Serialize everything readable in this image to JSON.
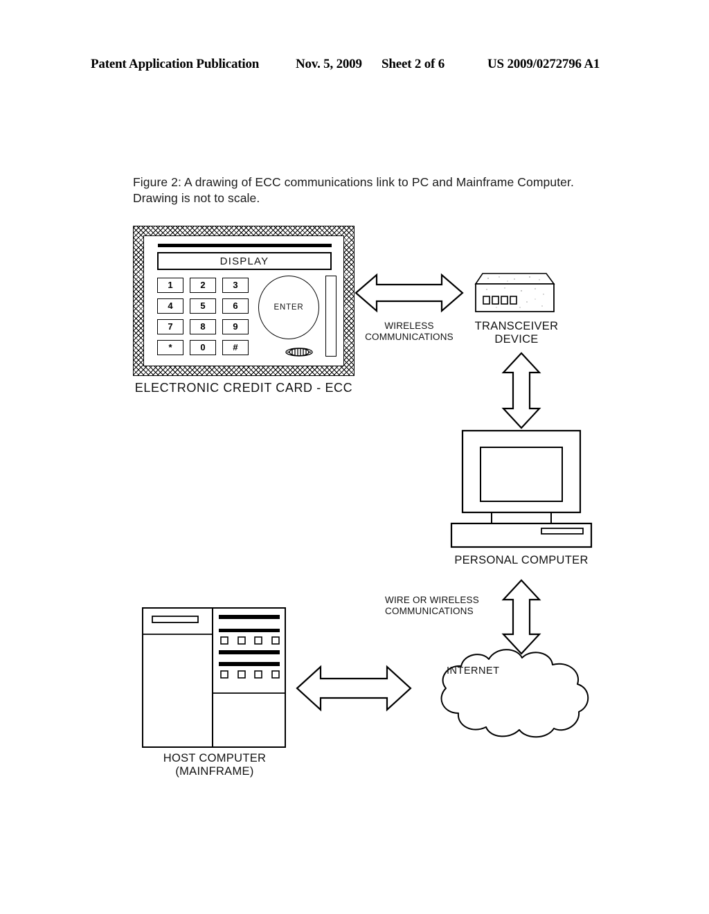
{
  "header": {
    "publication": "Patent Application Publication",
    "date": "Nov. 5, 2009",
    "sheet": "Sheet 2 of 6",
    "doc_number": "US 2009/0272796 A1"
  },
  "figure": {
    "caption": "Figure 2: A drawing of ECC communications link to PC and Mainframe Computer. Drawing is not to scale."
  },
  "diagram": {
    "ecc": {
      "display_label": "DISPLAY",
      "enter_label": "ENTER",
      "keys": [
        "1",
        "2",
        "3",
        "4",
        "5",
        "6",
        "7",
        "8",
        "9",
        "*",
        "0",
        "#"
      ],
      "caption": "ELECTRONIC CREDIT CARD - ECC"
    },
    "wireless_link_label": "WIRELESS\nCOMMUNICATIONS",
    "transceiver_label": "TRANSCEIVER\nDEVICE",
    "personal_computer_label": "PERSONAL COMPUTER",
    "wire_or_wireless_label": "WIRE OR WIRELESS\nCOMMUNICATIONS",
    "internet_label": "INTERNET",
    "host_computer_label": "HOST COMPUTER\n(MAINFRAME)"
  },
  "colors": {
    "ink": "#000000",
    "page": "#ffffff"
  }
}
